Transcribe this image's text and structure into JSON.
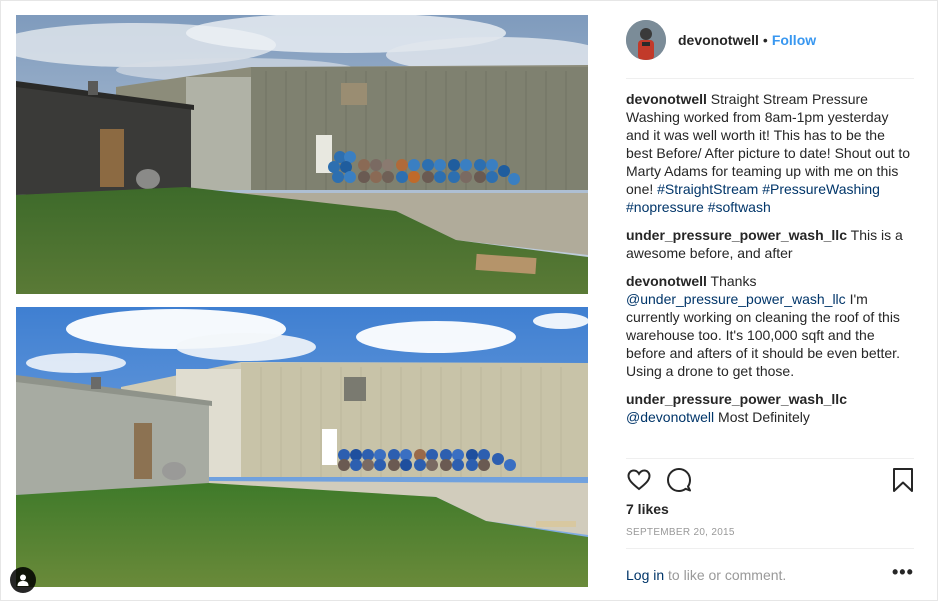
{
  "post": {
    "author": "devonotwell",
    "follow_separator": "•",
    "follow_label": "Follow",
    "caption": {
      "user": "devonotwell",
      "text": "Straight Stream Pressure Washing worked from 8am-1pm yesterday and it was well worth it! This has to be the best Before/ After picture to date! Shout out to Marty Adams for teaming up with me on this one!",
      "hashtags": "#StraightStream #PressureWashing #nopressure #softwash"
    },
    "comments": [
      {
        "user": "under_pressure_power_wash_llc",
        "text": "This is a awesome before, and after"
      },
      {
        "user": "devonotwell",
        "text_before": "Thanks",
        "mention": "@under_pressure_power_wash_llc",
        "text_after": "I'm currently working on cleaning the roof of this warehouse too. It's 100,000 sqft and the before and afters of it should be even better. Using a drone to get those."
      },
      {
        "user": "under_pressure_power_wash_llc",
        "mention": "@devonotwell",
        "text_after": "Most Definitely"
      }
    ],
    "likes": "7 likes",
    "date": "SEPTEMBER 20, 2015",
    "login_link": "Log in",
    "login_suffix": " to like or comment.",
    "more_label": "•••"
  },
  "icons": {
    "like": "heart-outline-icon",
    "comment": "speech-bubble-icon",
    "save": "bookmark-icon",
    "more": "more-options-icon",
    "user_tag": "person-tag-icon"
  },
  "colors": {
    "link_blue": "#3897f0",
    "hashtag_navy": "#003569",
    "muted": "#999999",
    "text": "#262626"
  }
}
